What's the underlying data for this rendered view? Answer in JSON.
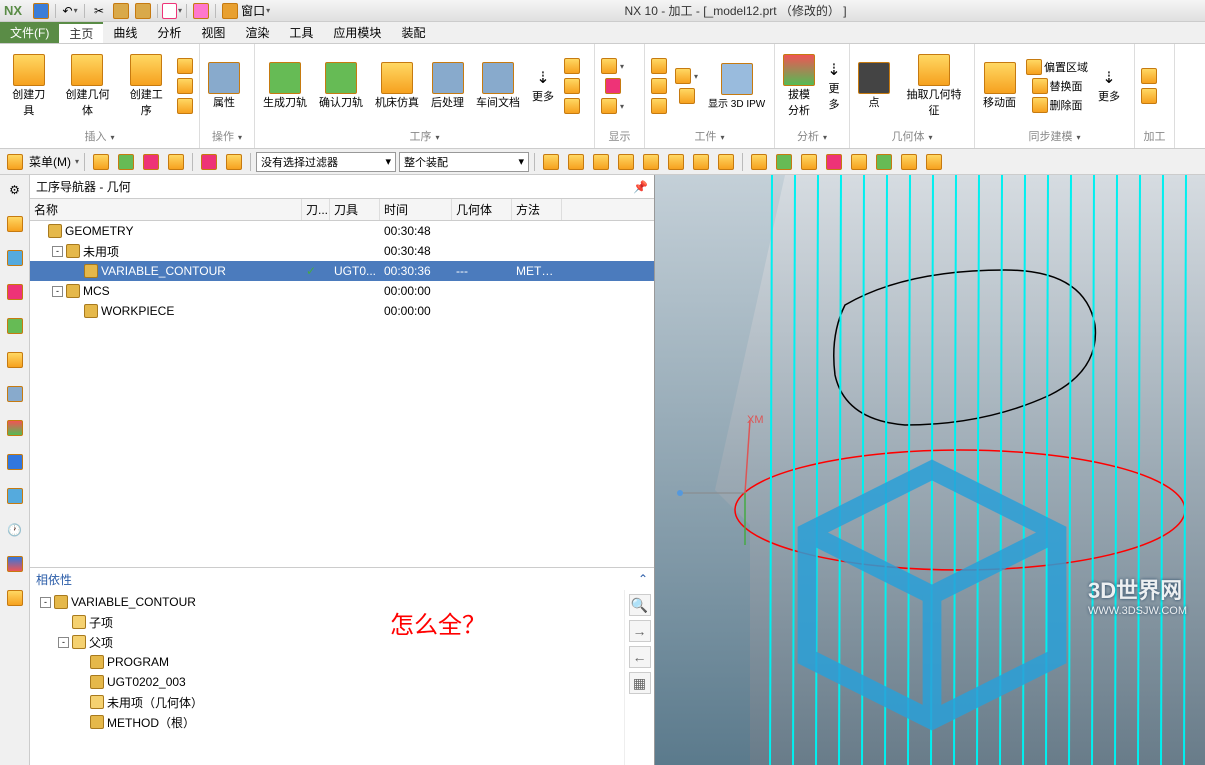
{
  "app": {
    "logo": "NX",
    "title": "NX 10 - 加工 - [_model12.prt （修改的） ]"
  },
  "qat": {
    "window_menu": "窗口"
  },
  "menus": {
    "file": "文件(F)",
    "home": "主页",
    "curve": "曲线",
    "analysis": "分析",
    "view": "视图",
    "render": "渲染",
    "tool": "工具",
    "app": "应用模块",
    "assembly": "装配"
  },
  "ribbon": {
    "insert": {
      "create_tool": "创建刀具",
      "create_geom": "创建几何体",
      "create_op": "创建工序",
      "label": "插入"
    },
    "op": {
      "attr": "属性",
      "label": "操作"
    },
    "process": {
      "gen": "生成刀轨",
      "confirm": "确认刀轨",
      "sim": "机床仿真",
      "post": "后处理",
      "shop": "车间文档",
      "more": "更多",
      "label": "工序"
    },
    "display": {
      "label": "显示"
    },
    "part": {
      "show_ipw": "显示 3D IPW",
      "label": "工件"
    },
    "analysis": {
      "draft": "拔模分析",
      "more": "更多",
      "label": "分析"
    },
    "geom": {
      "point": "点",
      "extract": "抽取几何特征",
      "label": "几何体"
    },
    "sync": {
      "move": "移动面",
      "offset": "偏置区域",
      "replace": "替换面",
      "delete": "删除面",
      "more": "更多",
      "label": "同步建模"
    },
    "machine": {
      "label": "加工"
    }
  },
  "toolbar": {
    "menu_btn": "菜单(M)",
    "filter_none": "没有选择过滤器",
    "assembly": "整个装配"
  },
  "navigator": {
    "title": "工序导航器 - 几何",
    "cols": {
      "name": "名称",
      "k": "刀...",
      "tool": "刀具",
      "time": "时间",
      "geom": "几何体",
      "method": "方法"
    },
    "rows": [
      {
        "indent": 0,
        "exp": "",
        "name": "GEOMETRY",
        "time": "00:30:48"
      },
      {
        "indent": 1,
        "exp": "-",
        "name": "未用项",
        "time": "00:30:48"
      },
      {
        "indent": 2,
        "exp": "",
        "name": "VARIABLE_CONTOUR",
        "k": "✓",
        "tool": "UGT0...",
        "time": "00:30:36",
        "geom": "---",
        "method": "METH...",
        "selected": true
      },
      {
        "indent": 1,
        "exp": "-",
        "name": "MCS",
        "time": "00:00:00"
      },
      {
        "indent": 2,
        "exp": "",
        "name": "WORKPIECE",
        "time": "00:00:00"
      }
    ],
    "annotation": "怎么全？"
  },
  "dependency": {
    "title": "相依性",
    "rows": [
      {
        "indent": 0,
        "exp": "-",
        "name": "VARIABLE_CONTOUR"
      },
      {
        "indent": 1,
        "exp": "",
        "name": "子项",
        "folder": true
      },
      {
        "indent": 1,
        "exp": "-",
        "name": "父项",
        "folder": true
      },
      {
        "indent": 2,
        "exp": "",
        "name": "PROGRAM"
      },
      {
        "indent": 2,
        "exp": "",
        "name": "UGT0202_003"
      },
      {
        "indent": 2,
        "exp": "",
        "name": "未用项（几何体）",
        "folder": true
      },
      {
        "indent": 2,
        "exp": "",
        "name": "METHOD（根）"
      }
    ]
  },
  "viewport": {
    "axis_xm": "XM"
  },
  "watermark": {
    "big": "3D世界网",
    "small": "WWW.3DSJW.COM"
  }
}
